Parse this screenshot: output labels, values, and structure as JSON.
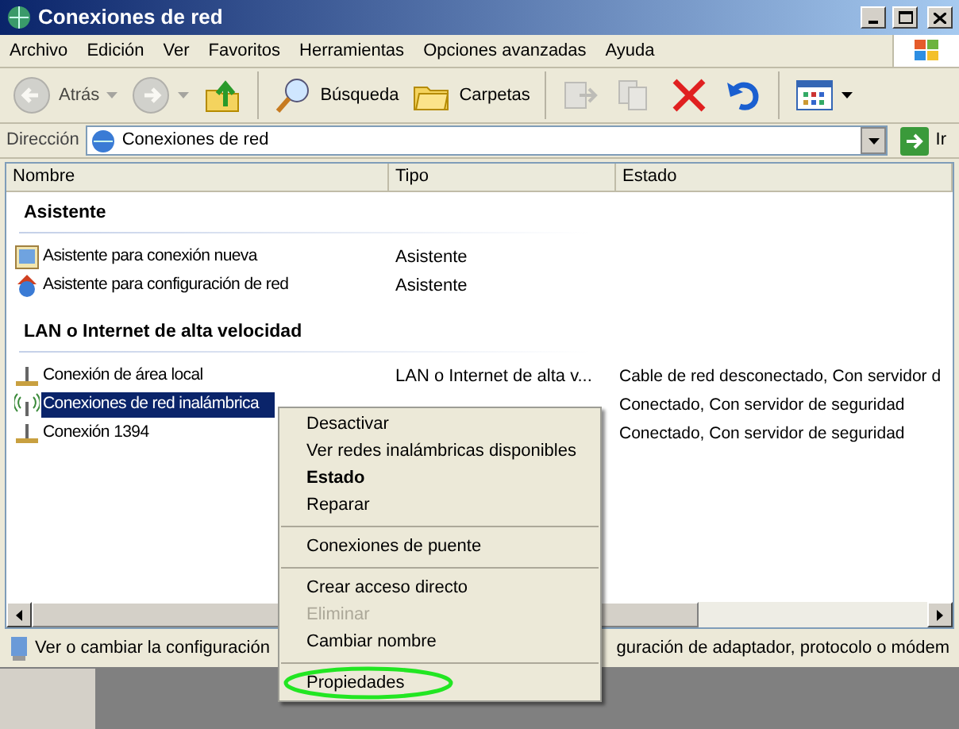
{
  "window": {
    "title": "Conexiones de red"
  },
  "menu_bar": [
    "Archivo",
    "Edición",
    "Ver",
    "Favoritos",
    "Herramientas",
    "Opciones avanzadas",
    "Ayuda"
  ],
  "toolbar": [
    {
      "kind": "back",
      "label": "Atrás",
      "disabled": true,
      "dropdown": true
    },
    {
      "kind": "forward",
      "disabled": true,
      "dropdown": true
    },
    {
      "kind": "up",
      "disabled": false
    },
    {
      "kind": "separator"
    },
    {
      "kind": "search",
      "label": "Búsqueda",
      "disabled": false
    },
    {
      "kind": "folders",
      "label": "Carpetas",
      "disabled": false
    },
    {
      "kind": "separator"
    },
    {
      "kind": "move",
      "disabled": true
    },
    {
      "kind": "copy",
      "disabled": true
    },
    {
      "kind": "delete",
      "disabled": false
    },
    {
      "kind": "undo",
      "disabled": false
    },
    {
      "kind": "separator"
    },
    {
      "kind": "views",
      "disabled": false,
      "dropdown": true
    }
  ],
  "address_bar": {
    "label": "Dirección",
    "value": "Conexiones de red",
    "go": "Ir"
  },
  "table": {
    "columns": [
      "Nombre",
      "Tipo",
      "Estado"
    ],
    "groups": [
      {
        "heading": "Asistente",
        "rows": [
          {
            "kind": "wizard",
            "name": "Asistente para conexión nueva",
            "type": "Asistente",
            "selected": false
          },
          {
            "kind": "network-wizard",
            "name": "Asistente para configuración de red",
            "type": "Asistente",
            "selected": false
          }
        ]
      },
      {
        "heading": "LAN o Internet de alta velocidad",
        "rows": [
          {
            "kind": "lan",
            "name": "Conexión de área local",
            "type": "LAN o Internet de alta v...",
            "status": "Cable de red desconectado, Con servidor d",
            "selected": false
          },
          {
            "kind": "wireless",
            "name": "Conexiones de red inalámbrica",
            "status": "Conectado, Con servidor de seguridad",
            "selected": true
          },
          {
            "kind": "lan",
            "name": "Conexión 1394",
            "status": "Conectado, Con servidor de seguridad",
            "selected": false
          }
        ]
      }
    ]
  },
  "status_bar": {
    "text_left": "Ver o cambiar la configuración",
    "text_right": "guración de adaptador, protocolo o módem"
  },
  "context_menu": [
    {
      "kind": "item",
      "label": "Desactivar",
      "default": false,
      "disabled": false
    },
    {
      "kind": "item",
      "label": "Ver redes inalámbricas disponibles",
      "default": false,
      "disabled": false
    },
    {
      "kind": "item",
      "label": "Estado",
      "default": true,
      "disabled": false
    },
    {
      "kind": "item",
      "label": "Reparar",
      "default": false,
      "disabled": false
    },
    {
      "kind": "separator"
    },
    {
      "kind": "item",
      "label": "Conexiones de puente",
      "default": false,
      "disabled": false
    },
    {
      "kind": "separator"
    },
    {
      "kind": "item",
      "label": "Crear acceso directo",
      "default": false,
      "disabled": false
    },
    {
      "kind": "item",
      "label": "Eliminar",
      "default": false,
      "disabled": true
    },
    {
      "kind": "item",
      "label": "Cambiar nombre",
      "default": false,
      "disabled": false
    },
    {
      "kind": "separator"
    },
    {
      "kind": "item",
      "label": "Propiedades",
      "default": false,
      "disabled": false,
      "circled": true
    }
  ]
}
